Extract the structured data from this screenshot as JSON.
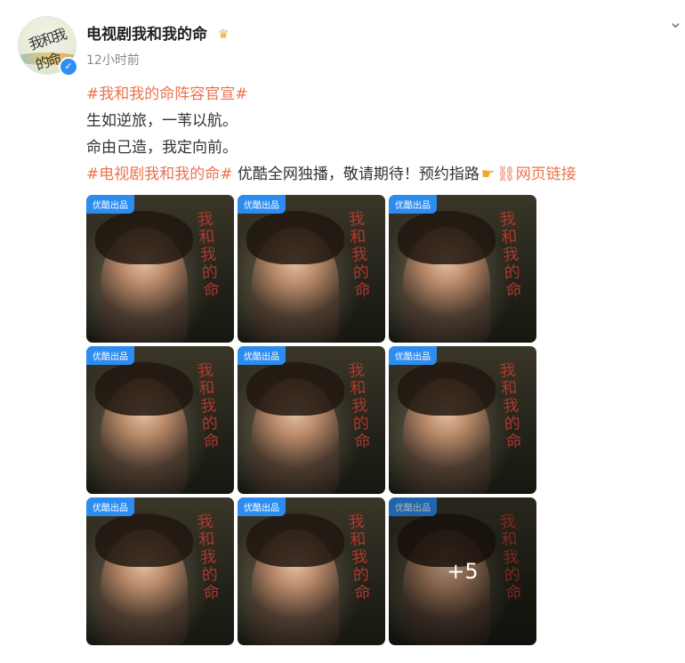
{
  "post": {
    "author": "电视剧我和我的命",
    "time": "12小时前",
    "hashtag1": "#我和我的命阵容官宣#",
    "line2": "生如逆旅，一苇以航。",
    "line3": "命由己造，我定向前。",
    "hashtag2": "#电视剧我和我的命#",
    "text4": " 优酷全网独播，敬请期待！预约指路",
    "link_text": "网页链接"
  },
  "avatar": {
    "calli": "我和我的命"
  },
  "icons": {
    "verified": "verified-badge-icon",
    "crown": "crown-icon",
    "chevron": "chevron-down-icon",
    "pointer": "pointing-hand-icon",
    "link": "link-icon"
  },
  "images": [
    {
      "badge": "优酷出品",
      "calli": "我和我的命"
    },
    {
      "badge": "优酷出品",
      "calli": "我和我的命"
    },
    {
      "badge": "优酷出品",
      "calli": "我和我的命"
    },
    {
      "badge": "优酷出品",
      "calli": "我和我的命"
    },
    {
      "badge": "优酷出品",
      "calli": "我和我的命"
    },
    {
      "badge": "优酷出品",
      "calli": "我和我的命"
    },
    {
      "badge": "优酷出品",
      "calli": "我和我的命"
    },
    {
      "badge": "优酷出品",
      "calli": "我和我的命"
    },
    {
      "badge": "优酷出品",
      "calli": "我和我的命",
      "more": "+5"
    }
  ],
  "colors": {
    "link": "#eb7350",
    "badge": "#2d8cf0",
    "calli_red": "#b23a2e"
  }
}
